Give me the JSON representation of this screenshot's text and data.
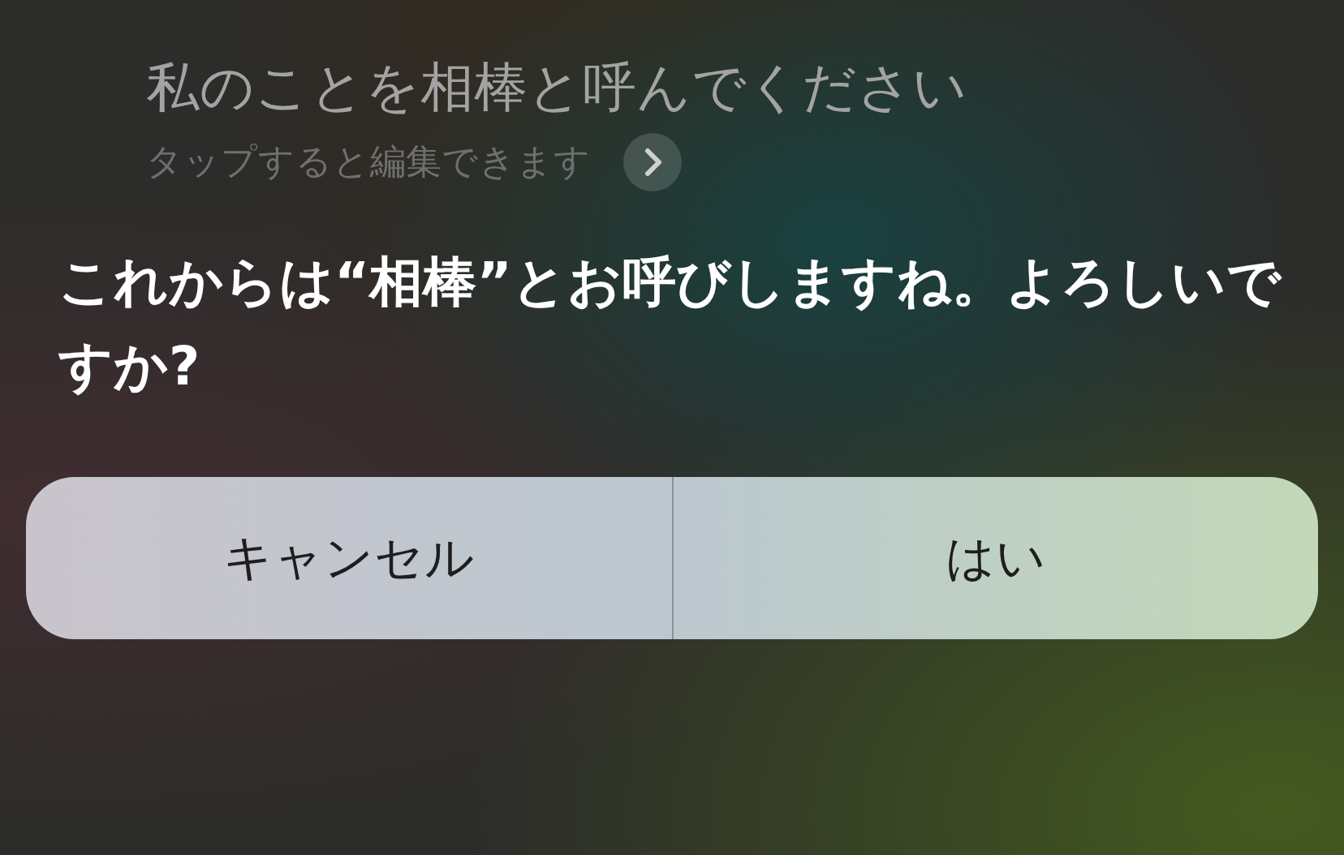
{
  "query": {
    "text": "私のことを相棒と呼んでください",
    "hint": "タップすると編集できます"
  },
  "response": {
    "text": "これからは“相棒”とお呼びしますね。よろしいですか?"
  },
  "buttons": [
    {
      "label": "キャンセル"
    },
    {
      "label": "はい"
    }
  ]
}
